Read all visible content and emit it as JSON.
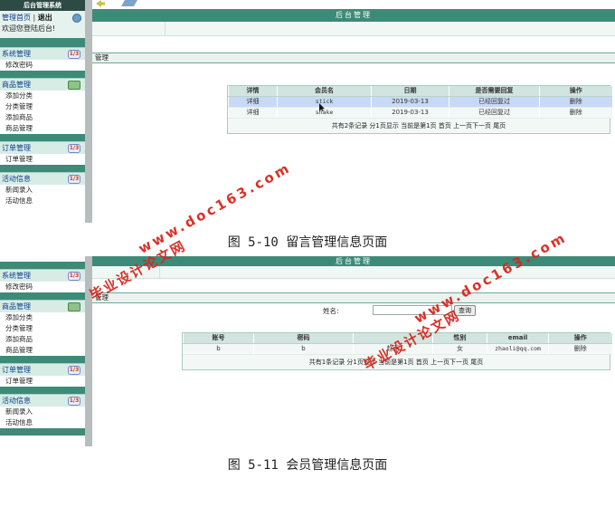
{
  "shot1": {
    "sidebar": {
      "header": "后台管理系统",
      "home_link": "管理首页",
      "separator": "|",
      "exit_link": "退出",
      "welcome": "欢迎您登陆后台!",
      "groups": [
        {
          "title": "系统管理",
          "items": [
            "修改密码"
          ]
        },
        {
          "title": "商品管理",
          "items": [
            "添加分类",
            "分类管理",
            "添加商品",
            "商品管理"
          ]
        },
        {
          "title": "订单管理",
          "items": [
            "订单管理"
          ]
        },
        {
          "title": "活动信息",
          "items": [
            "新闻录入",
            "活动信息"
          ]
        }
      ]
    },
    "main": {
      "title": "后台管理",
      "section": "管理",
      "table": {
        "columns": [
          "详情",
          "会员名",
          "日期",
          "是否需要回复",
          "操作"
        ],
        "rows": [
          {
            "detail": "详细",
            "member": "stick",
            "date": "2019-03-13",
            "reply": "已经回复过",
            "action": "删除"
          },
          {
            "detail": "详细",
            "member": "snake",
            "date": "2019-03-13",
            "reply": "已经回复过",
            "action": "删除"
          }
        ],
        "pager": "共有2条记录  分1页显示  当前是第1页  首页  上一页下一页  尾页"
      }
    },
    "caption": "图 5-10 留言管理信息页面"
  },
  "shot2": {
    "sidebar": {
      "groups": [
        {
          "title": "系统管理",
          "items": [
            "修改密码"
          ]
        },
        {
          "title": "商品管理",
          "items": [
            "添加分类",
            "分类管理",
            "添加商品",
            "商品管理"
          ]
        },
        {
          "title": "订单管理",
          "items": [
            "订单管理"
          ]
        },
        {
          "title": "活动信息",
          "items": [
            "新闻录入",
            "活动信息"
          ]
        }
      ]
    },
    "main": {
      "title": "后台管理",
      "section": "管理",
      "search": {
        "label": "姓名:",
        "value": "",
        "button": "查询"
      },
      "table": {
        "columns": [
          "账号",
          "密码",
          "",
          "性别",
          "email",
          "操作"
        ],
        "rows": [
          {
            "account": "b",
            "password": "b",
            "name": "赵丽",
            "gender": "女",
            "email": "zhaoli@qq.com",
            "action": "删除"
          }
        ],
        "pager": "共有1条记录  分1页显示  当前是第1页  首页  上一页下一页  尾页"
      }
    },
    "caption": "图 5-11 会员管理信息页面"
  },
  "watermark": {
    "url": "www.doc163.com",
    "text": "毕业设计论文网",
    "color": "#d6281e"
  }
}
